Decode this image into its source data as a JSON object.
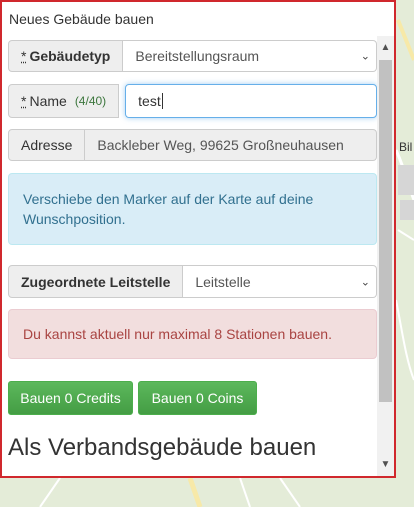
{
  "panel": {
    "title": "Neues Gebäude bauen"
  },
  "form": {
    "building_type": {
      "label": "Gebäudetyp",
      "required_mark": "*",
      "value": "Bereitstellungsraum"
    },
    "name": {
      "label": "Name",
      "required_mark": "*",
      "counter": "(4/40)",
      "value": "test"
    },
    "address": {
      "label": "Adresse",
      "value": "Backleber Weg, 99625 Großneuhausen"
    },
    "info_message": "Verschiebe den Marker auf der Karte auf deine Wunschposition.",
    "dispatch": {
      "label": "Zugeordnete Leitstelle",
      "value": "Leitstelle"
    },
    "error_message": "Du kannst aktuell nur maximal 8 Stationen bauen."
  },
  "buttons": {
    "build_credits": "Bauen 0 Credits",
    "build_coins": "Bauen 0 Coins"
  },
  "section_heading": "Als Verbandsgebäude bauen",
  "map": {
    "label_partial": "Bil"
  },
  "colors": {
    "panel_border": "#d0282d",
    "success": "#5cb85c",
    "info_bg": "#d9edf7",
    "danger_bg": "#f2dede"
  }
}
